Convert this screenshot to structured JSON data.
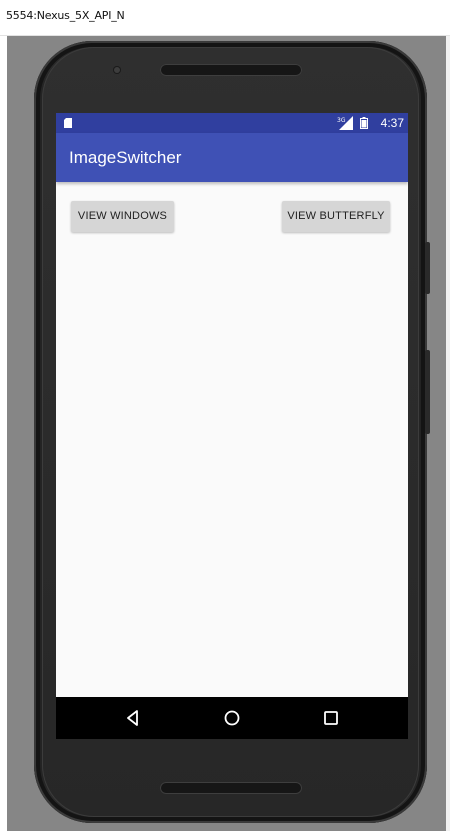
{
  "window": {
    "title": "5554:Nexus_5X_API_N"
  },
  "status_bar": {
    "time": "4:37",
    "network": "3G",
    "icons": [
      "sd-card-icon",
      "signal-icon",
      "battery-icon"
    ]
  },
  "app_bar": {
    "title": "ImageSwitcher"
  },
  "main": {
    "buttons": [
      {
        "label": "VIEW WINDOWS"
      },
      {
        "label": "VIEW BUTTERFLY"
      }
    ]
  },
  "nav_bar": {
    "icons": [
      "back-icon",
      "home-icon",
      "recents-icon"
    ]
  },
  "colors": {
    "primary": "#3f51b5",
    "primary_dark": "#303f9f",
    "background": "#fafafa",
    "button": "#d6d6d6",
    "emulator_backdrop": "#868686",
    "device": "#262626"
  }
}
